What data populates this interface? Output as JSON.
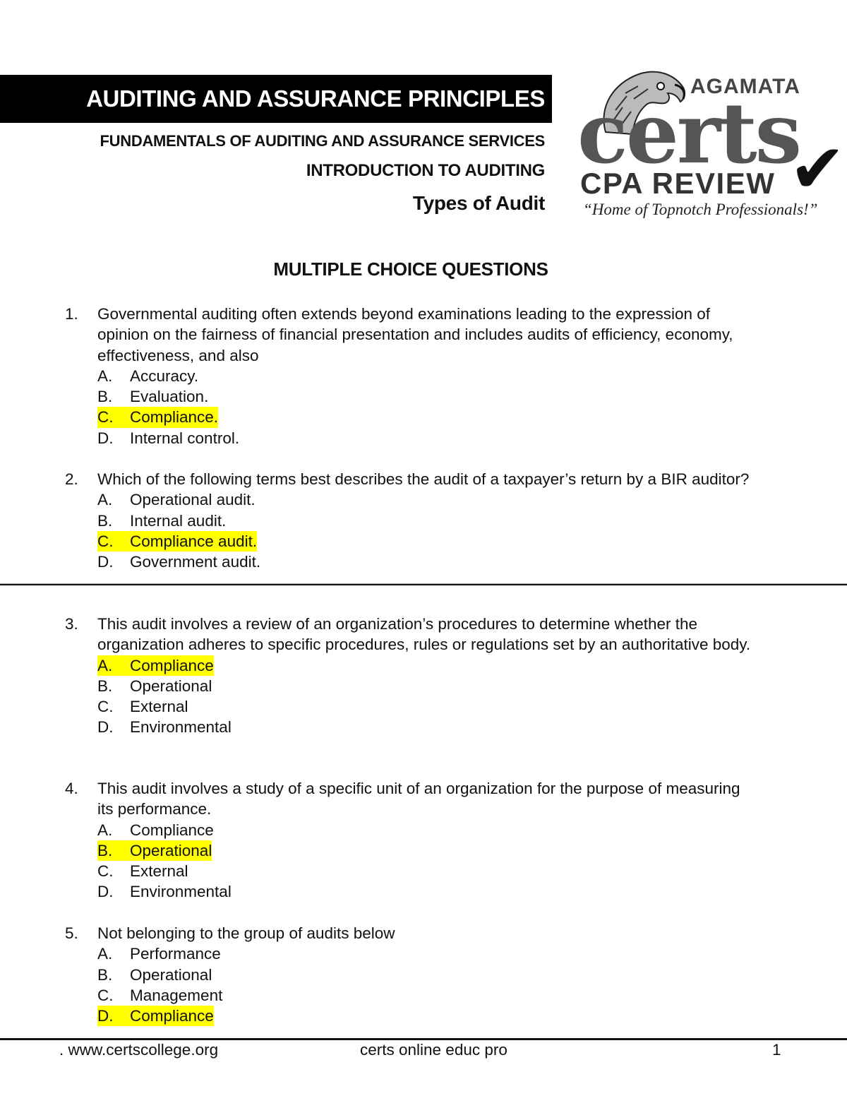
{
  "header": {
    "course_title": "AUDITING AND ASSURANCE PRINCIPLES",
    "subtitle_1": "FUNDAMENTALS OF AUDITING AND ASSURANCE SERVICES",
    "subtitle_2": "INTRODUCTION TO AUDITING",
    "topic": "Types of Audit"
  },
  "logo": {
    "top_text": "AGAMATA",
    "brand": "certs",
    "sub_brand": "CPA REVIEW",
    "check_glyph": "✔",
    "tagline": "“Home of Topnotch Professionals!”",
    "icon": "eagle-head-icon"
  },
  "section_title": "MULTIPLE CHOICE QUESTIONS",
  "highlight_color": "#ffff00",
  "questions": [
    {
      "number": "1.",
      "text": "Governmental auditing often extends beyond examinations leading to the expression of opinion on the fairness of financial presentation and includes audits of efficiency, economy, effectiveness, and also",
      "options": [
        {
          "letter": "A.",
          "text": "Accuracy.",
          "highlighted": false
        },
        {
          "letter": "B.",
          "text": "Evaluation.",
          "highlighted": false
        },
        {
          "letter": "C.",
          "text": "Compliance.",
          "highlighted": true
        },
        {
          "letter": "D.",
          "text": "Internal control.",
          "highlighted": false
        }
      ]
    },
    {
      "number": "2.",
      "text": "Which of the following terms best describes the audit of a taxpayer’s return by a BIR auditor?",
      "options": [
        {
          "letter": "A.",
          "text": "Operational audit.",
          "highlighted": false
        },
        {
          "letter": "B.",
          "text": "Internal audit.",
          "highlighted": false
        },
        {
          "letter": "C.",
          "text": "Compliance audit.",
          "highlighted": true
        },
        {
          "letter": "D.",
          "text": "Government audit.",
          "highlighted": false
        }
      ]
    },
    {
      "number": "3.",
      "text": "This audit involves a review of an organization’s procedures to determine whether the organization adheres to specific procedures, rules or regulations set by an authoritative body.",
      "options": [
        {
          "letter": "A.",
          "text": "Compliance",
          "highlighted": true
        },
        {
          "letter": "B.",
          "text": "Operational",
          "highlighted": false
        },
        {
          "letter": "C.",
          "text": "External",
          "highlighted": false
        },
        {
          "letter": "D.",
          "text": "Environmental",
          "highlighted": false
        }
      ]
    },
    {
      "number": "4.",
      "text": "This audit involves a study of a specific unit of an organization for the purpose of measuring its performance.",
      "options": [
        {
          "letter": "A.",
          "text": "Compliance",
          "highlighted": false
        },
        {
          "letter": "B.",
          "text": "Operational",
          "highlighted": true
        },
        {
          "letter": "C.",
          "text": "External",
          "highlighted": false
        },
        {
          "letter": "D.",
          "text": "Environmental",
          "highlighted": false
        }
      ]
    },
    {
      "number": "5.",
      "text": "Not belonging to the group of audits below",
      "options": [
        {
          "letter": "A.",
          "text": "Performance",
          "highlighted": false
        },
        {
          "letter": "B.",
          "text": "Operational",
          "highlighted": false
        },
        {
          "letter": "C.",
          "text": "Management",
          "highlighted": false
        },
        {
          "letter": "D.",
          "text": "Compliance",
          "highlighted": true
        }
      ]
    }
  ],
  "footer": {
    "website": ". www.certscollege.org",
    "center_text": "certs online educ pro",
    "page_number": "1"
  }
}
